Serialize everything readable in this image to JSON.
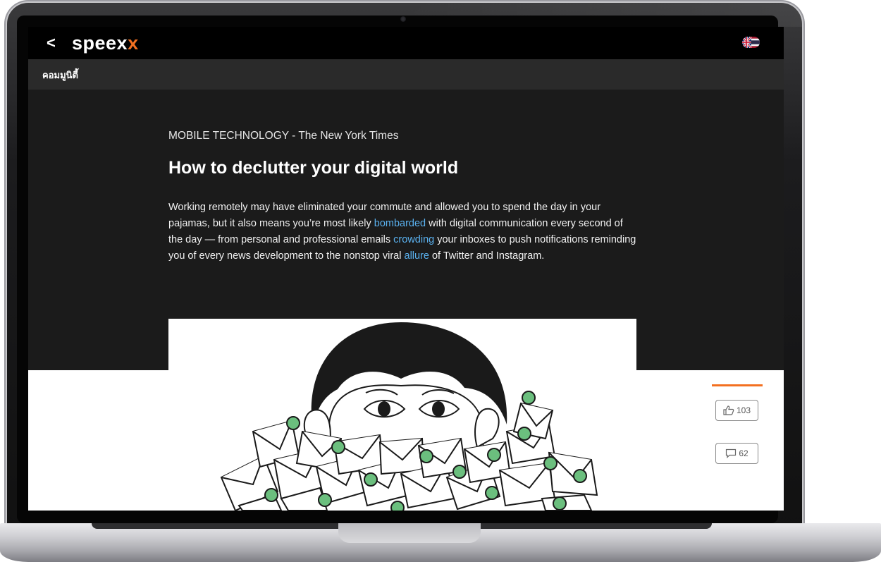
{
  "app": {
    "logo_main": "speex",
    "logo_accent": "x",
    "back_icon": "chevron-left-icon",
    "language_icon": "uk-thai-flag-icon"
  },
  "subnav": {
    "label": "คอมมูนิตี้"
  },
  "article": {
    "kicker": "MOBILE TECHNOLOGY - The New York Times",
    "title": "How to declutter your digital world",
    "body_parts": {
      "p1": "Working remotely may have eliminated your commute and allowed you to spend the day in your pajamas, but it also means you’re most likely ",
      "v1": "bombarded",
      "p2": " with digital communication every second of the day — from personal and professional emails ",
      "v2": "crowding",
      "p3": " your inboxes to push notifications reminding you of every news development to the nonstop viral ",
      "v3": "allure",
      "p4": " of Twitter and Instagram."
    },
    "illustration_icon": "person-buried-in-emails-illustration"
  },
  "engagement": {
    "likes": "103",
    "comments": "62",
    "like_icon": "thumbs-up-icon",
    "comment_icon": "speech-bubble-icon",
    "accent_color": "#f37021"
  },
  "colors": {
    "vocab_link": "#5ab1ef",
    "brand_accent": "#f37021",
    "dark_bg": "#1b1b1b"
  }
}
